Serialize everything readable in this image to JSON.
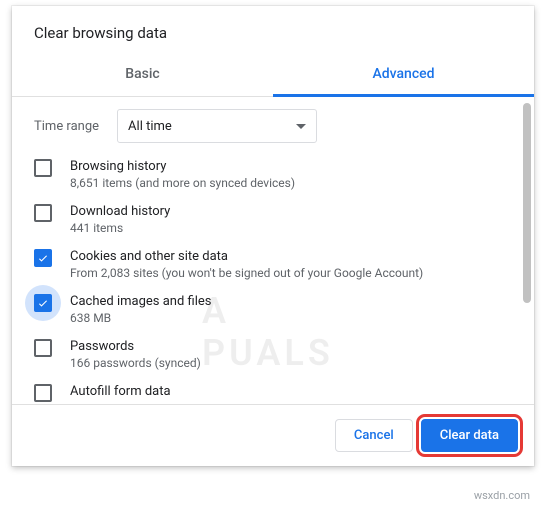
{
  "dialog": {
    "title": "Clear browsing data"
  },
  "tabs": {
    "basic": "Basic",
    "advanced": "Advanced"
  },
  "time_range": {
    "label": "Time range",
    "value": "All time"
  },
  "options": [
    {
      "title": "Browsing history",
      "sub": "8,651 items (and more on synced devices)",
      "checked": false,
      "highlight": false
    },
    {
      "title": "Download history",
      "sub": "441 items",
      "checked": false,
      "highlight": false
    },
    {
      "title": "Cookies and other site data",
      "sub": "From 2,083 sites (you won't be signed out of your Google Account)",
      "checked": true,
      "highlight": false
    },
    {
      "title": "Cached images and files",
      "sub": "638 MB",
      "checked": true,
      "highlight": true
    },
    {
      "title": "Passwords",
      "sub": "166 passwords (synced)",
      "checked": false,
      "highlight": false
    },
    {
      "title": "Autofill form data",
      "sub": "",
      "checked": false,
      "highlight": false
    }
  ],
  "footer": {
    "cancel": "Cancel",
    "clear": "Clear data"
  },
  "watermark": {
    "logo": "A PUALS",
    "site": "wsxdn.com"
  }
}
